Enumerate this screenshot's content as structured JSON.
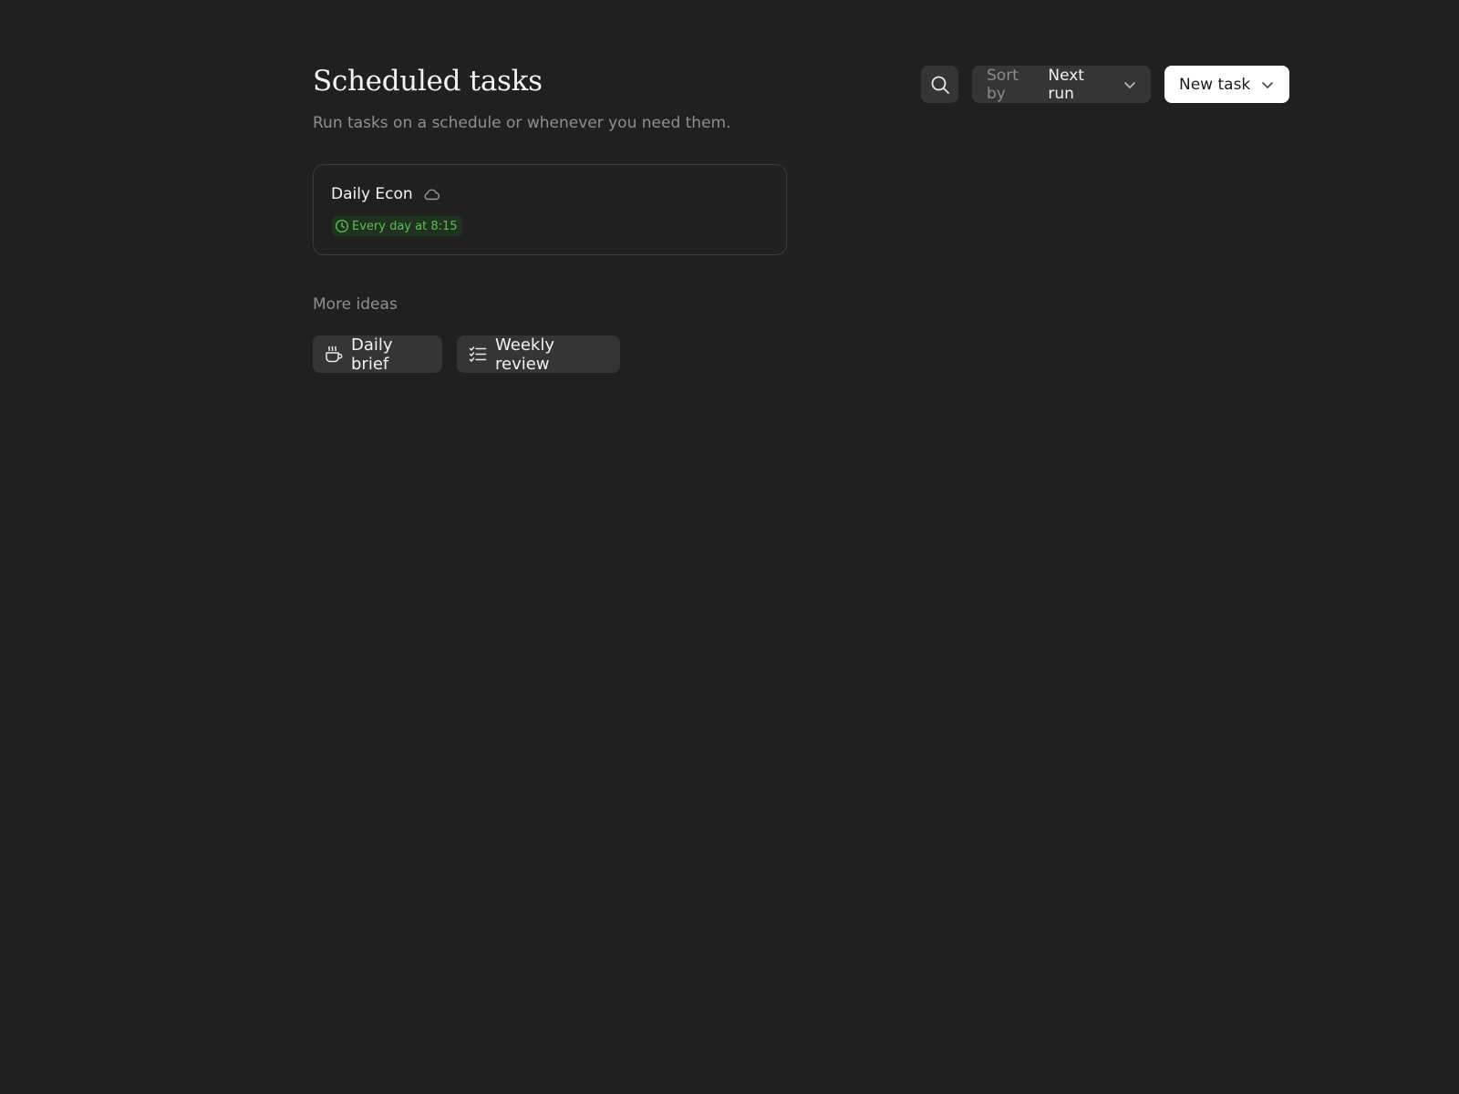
{
  "header": {
    "title": "Scheduled tasks",
    "subtitle": "Run tasks on a schedule or whenever you need them.",
    "search_icon": "search-icon",
    "sort": {
      "prefix": "Sort by",
      "value": "Next run"
    },
    "new_task_label": "New task"
  },
  "tasks": [
    {
      "name": "Daily Econ",
      "icon": "cloud-icon",
      "schedule": "Every day at 8:15",
      "schedule_color": "#5dbb54"
    }
  ],
  "ideas": {
    "label": "More ideas",
    "items": [
      {
        "label": "Daily brief",
        "icon": "coffee-cup-icon"
      },
      {
        "label": "Weekly review",
        "icon": "checklist-icon"
      }
    ]
  },
  "colors": {
    "background": "#202020",
    "surface": "#353535",
    "primary_button": "#ffffff",
    "accent_green": "#5dbb54"
  }
}
